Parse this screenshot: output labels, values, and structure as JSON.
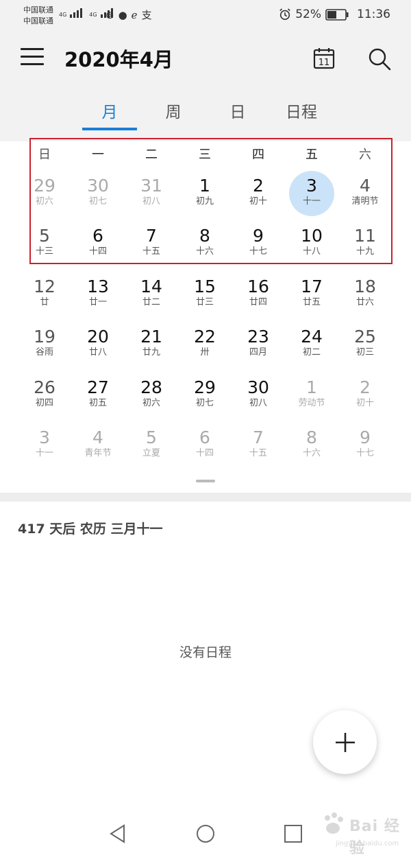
{
  "status_bar": {
    "carrier_1": "中国联通",
    "carrier_2": "中国联通",
    "network_1": "4G",
    "network_2": "4G",
    "notif_icons": [
      "weibo-icon",
      "chat-icon",
      "browser-icon",
      "alipay-icon"
    ],
    "notif_glyphs": [
      "⊚",
      "●",
      "ℯ",
      "支"
    ],
    "battery_percent": "52%",
    "battery_level": 0.52,
    "time": "11:36"
  },
  "header": {
    "title": "2020年4月",
    "today_icon_day": "11"
  },
  "tabs": [
    {
      "label": "月",
      "active": true
    },
    {
      "label": "周",
      "active": false
    },
    {
      "label": "日",
      "active": false
    },
    {
      "label": "日程",
      "active": false
    }
  ],
  "weekdays": [
    "日",
    "一",
    "二",
    "三",
    "四",
    "五",
    "六"
  ],
  "weeks": [
    [
      {
        "day": "29",
        "lunar": "初六",
        "other": true
      },
      {
        "day": "30",
        "lunar": "初七",
        "other": true
      },
      {
        "day": "31",
        "lunar": "初八",
        "other": true
      },
      {
        "day": "1",
        "lunar": "初九"
      },
      {
        "day": "2",
        "lunar": "初十"
      },
      {
        "day": "3",
        "lunar": "十一",
        "today": true
      },
      {
        "day": "4",
        "lunar": "清明节"
      }
    ],
    [
      {
        "day": "5",
        "lunar": "十三"
      },
      {
        "day": "6",
        "lunar": "十四"
      },
      {
        "day": "7",
        "lunar": "十五"
      },
      {
        "day": "8",
        "lunar": "十六"
      },
      {
        "day": "9",
        "lunar": "十七"
      },
      {
        "day": "10",
        "lunar": "十八"
      },
      {
        "day": "11",
        "lunar": "十九"
      }
    ],
    [
      {
        "day": "12",
        "lunar": "廿"
      },
      {
        "day": "13",
        "lunar": "廿一"
      },
      {
        "day": "14",
        "lunar": "廿二"
      },
      {
        "day": "15",
        "lunar": "廿三"
      },
      {
        "day": "16",
        "lunar": "廿四"
      },
      {
        "day": "17",
        "lunar": "廿五"
      },
      {
        "day": "18",
        "lunar": "廿六"
      }
    ],
    [
      {
        "day": "19",
        "lunar": "谷雨"
      },
      {
        "day": "20",
        "lunar": "廿八"
      },
      {
        "day": "21",
        "lunar": "廿九"
      },
      {
        "day": "22",
        "lunar": "卅"
      },
      {
        "day": "23",
        "lunar": "四月"
      },
      {
        "day": "24",
        "lunar": "初二"
      },
      {
        "day": "25",
        "lunar": "初三"
      }
    ],
    [
      {
        "day": "26",
        "lunar": "初四"
      },
      {
        "day": "27",
        "lunar": "初五"
      },
      {
        "day": "28",
        "lunar": "初六"
      },
      {
        "day": "29",
        "lunar": "初七"
      },
      {
        "day": "30",
        "lunar": "初八"
      },
      {
        "day": "1",
        "lunar": "劳动节",
        "other": true
      },
      {
        "day": "2",
        "lunar": "初十",
        "other": true
      }
    ],
    [
      {
        "day": "3",
        "lunar": "十一",
        "other": true
      },
      {
        "day": "4",
        "lunar": "青年节",
        "other": true
      },
      {
        "day": "5",
        "lunar": "立夏",
        "other": true
      },
      {
        "day": "6",
        "lunar": "十四",
        "other": true
      },
      {
        "day": "7",
        "lunar": "十五",
        "other": true
      },
      {
        "day": "8",
        "lunar": "十六",
        "other": true
      },
      {
        "day": "9",
        "lunar": "十七",
        "other": true
      }
    ]
  ],
  "info": {
    "line": "417 天后  农历 三月十一"
  },
  "empty_state": "没有日程",
  "colors": {
    "accent": "#1a7fd6",
    "today_bg": "#cbe3f8",
    "highlight_border": "#c8202e"
  },
  "watermark": {
    "text": "Bai 经验",
    "sub": "jingyan.baidu.com"
  }
}
